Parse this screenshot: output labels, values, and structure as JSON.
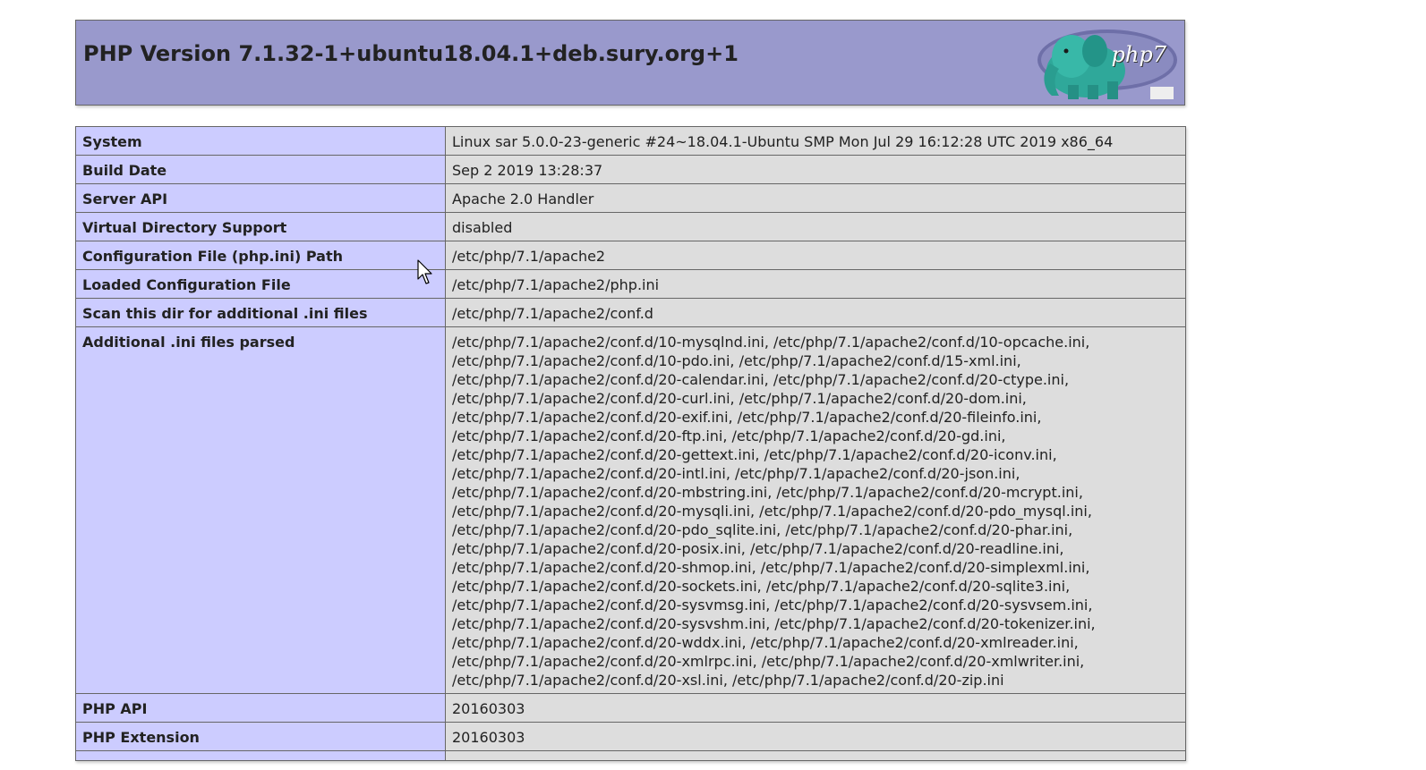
{
  "header": {
    "title": "PHP Version 7.1.32-1+ubuntu18.04.1+deb.sury.org+1",
    "logo_icon": "php-elephant-logo-icon",
    "logo_text": "php7"
  },
  "colors": {
    "header_bg": "#9999cc",
    "label_bg": "#ccccff",
    "value_bg": "#dddddd",
    "border": "#666666"
  },
  "rows": [
    {
      "label": "System",
      "value": "Linux sar 5.0.0-23-generic #24~18.04.1-Ubuntu SMP Mon Jul 29 16:12:28 UTC 2019 x86_64"
    },
    {
      "label": "Build Date",
      "value": "Sep 2 2019 13:28:37"
    },
    {
      "label": "Server API",
      "value": "Apache 2.0 Handler"
    },
    {
      "label": "Virtual Directory Support",
      "value": "disabled"
    },
    {
      "label": "Configuration File (php.ini) Path",
      "value": "/etc/php/7.1/apache2"
    },
    {
      "label": "Loaded Configuration File",
      "value": "/etc/php/7.1/apache2/php.ini"
    },
    {
      "label": "Scan this dir for additional .ini files",
      "value": "/etc/php/7.1/apache2/conf.d"
    },
    {
      "label": "Additional .ini files parsed",
      "value": "/etc/php/7.1/apache2/conf.d/10-mysqlnd.ini, /etc/php/7.1/apache2/conf.d/10-opcache.ini,\n/etc/php/7.1/apache2/conf.d/10-pdo.ini, /etc/php/7.1/apache2/conf.d/15-xml.ini,\n/etc/php/7.1/apache2/conf.d/20-calendar.ini, /etc/php/7.1/apache2/conf.d/20-ctype.ini,\n/etc/php/7.1/apache2/conf.d/20-curl.ini, /etc/php/7.1/apache2/conf.d/20-dom.ini,\n/etc/php/7.1/apache2/conf.d/20-exif.ini, /etc/php/7.1/apache2/conf.d/20-fileinfo.ini,\n/etc/php/7.1/apache2/conf.d/20-ftp.ini, /etc/php/7.1/apache2/conf.d/20-gd.ini,\n/etc/php/7.1/apache2/conf.d/20-gettext.ini, /etc/php/7.1/apache2/conf.d/20-iconv.ini,\n/etc/php/7.1/apache2/conf.d/20-intl.ini, /etc/php/7.1/apache2/conf.d/20-json.ini,\n/etc/php/7.1/apache2/conf.d/20-mbstring.ini, /etc/php/7.1/apache2/conf.d/20-mcrypt.ini,\n/etc/php/7.1/apache2/conf.d/20-mysqli.ini, /etc/php/7.1/apache2/conf.d/20-pdo_mysql.ini,\n/etc/php/7.1/apache2/conf.d/20-pdo_sqlite.ini, /etc/php/7.1/apache2/conf.d/20-phar.ini,\n/etc/php/7.1/apache2/conf.d/20-posix.ini, /etc/php/7.1/apache2/conf.d/20-readline.ini,\n/etc/php/7.1/apache2/conf.d/20-shmop.ini, /etc/php/7.1/apache2/conf.d/20-simplexml.ini,\n/etc/php/7.1/apache2/conf.d/20-sockets.ini, /etc/php/7.1/apache2/conf.d/20-sqlite3.ini,\n/etc/php/7.1/apache2/conf.d/20-sysvmsg.ini, /etc/php/7.1/apache2/conf.d/20-sysvsem.ini,\n/etc/php/7.1/apache2/conf.d/20-sysvshm.ini, /etc/php/7.1/apache2/conf.d/20-tokenizer.ini,\n/etc/php/7.1/apache2/conf.d/20-wddx.ini, /etc/php/7.1/apache2/conf.d/20-xmlreader.ini,\n/etc/php/7.1/apache2/conf.d/20-xmlrpc.ini, /etc/php/7.1/apache2/conf.d/20-xmlwriter.ini,\n/etc/php/7.1/apache2/conf.d/20-xsl.ini, /etc/php/7.1/apache2/conf.d/20-zip.ini"
    },
    {
      "label": "PHP API",
      "value": "20160303"
    },
    {
      "label": "PHP Extension",
      "value": "20160303"
    },
    {
      "label": "",
      "value": ""
    }
  ]
}
